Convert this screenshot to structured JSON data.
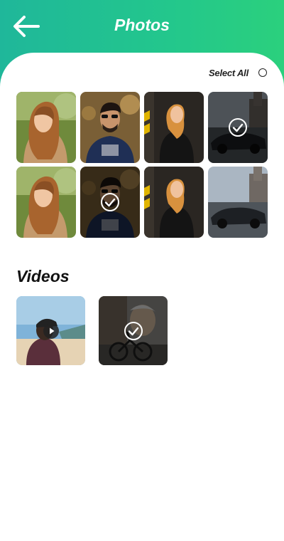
{
  "header": {
    "title": "Photos",
    "back_icon": "back-arrow-icon",
    "gradient": [
      "#1fb79a",
      "#2bd07d"
    ]
  },
  "select_all": {
    "label": "Select All",
    "checked": false
  },
  "photos": [
    {
      "subject": "woman-outdoors",
      "selected": false
    },
    {
      "subject": "man-sunglasses",
      "selected": false
    },
    {
      "subject": "woman-leather-jacket",
      "selected": false
    },
    {
      "subject": "dark-car",
      "selected": true
    },
    {
      "subject": "woman-outdoors",
      "selected": false
    },
    {
      "subject": "man-sunglasses",
      "selected": true
    },
    {
      "subject": "woman-leather-jacket",
      "selected": false
    },
    {
      "subject": "dark-car",
      "selected": false
    }
  ],
  "videos": {
    "heading": "Videos",
    "items": [
      {
        "subject": "woman-beach",
        "selected": false,
        "icon": "play-icon"
      },
      {
        "subject": "man-bicycle",
        "selected": true,
        "icon": "check-icon"
      }
    ]
  },
  "colors": {
    "check": "#ffffff",
    "overlay": "rgba(0,0,0,0.55)"
  }
}
